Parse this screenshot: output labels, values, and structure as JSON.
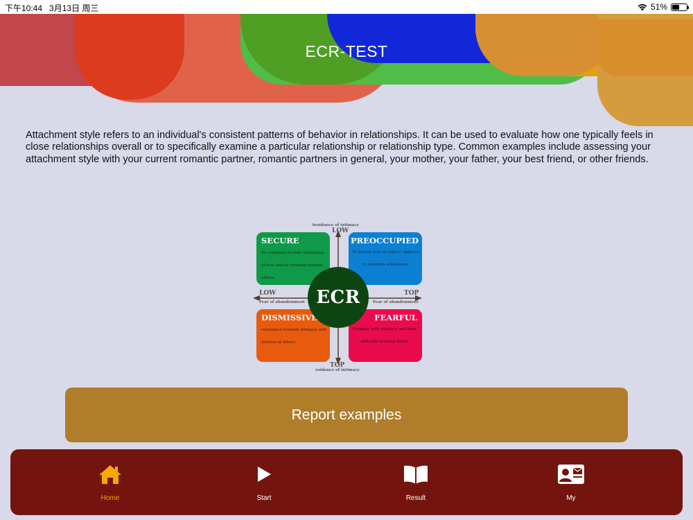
{
  "status_bar": {
    "time": "下午10:44",
    "date": "3月13日 周三",
    "battery": "51%",
    "battery_level": 0.51
  },
  "header": {
    "title": "ECR-TEST"
  },
  "description": "Attachment style refers to an individual's consistent patterns of behavior in relationships. It can be used to evaluate how one typically feels in close relationships overall or to specifically examine a particular relationship or relationship type. Common examples include assessing your attachment style with your current romantic partner, romantic partners in general, your mother, your father, your best friend, or other friends.",
  "diagram": {
    "center": "ECR",
    "axes": {
      "vertical_caption_top": "Avoidance of intimacy",
      "vertical_low": "LOW",
      "vertical_top": "TOP",
      "vertical_caption_bottom": "voidance of intimacy",
      "horizontal_low": "LOW",
      "horizontal_caption_left": "Fear of abandonment",
      "horizontal_top": "TOP",
      "horizontal_caption_right": "Fear of abandonment"
    },
    "quadrants": {
      "secure": {
        "title": "SECURE",
        "desc": "Be confident in their worthiness of love and be trusting towards others.",
        "color": "#0e9a48"
      },
      "preoccupied": {
        "title": "PREOCCUPIED",
        "desc": "To heavily rely on others' approval to maintain self-esteem.",
        "color": "#0b80d3"
      },
      "dismissive": {
        "title": "DISMISSIVE",
        "desc": "reluctance towards intimacy and distrust of others",
        "color": "#e85b0e"
      },
      "fearful": {
        "title": "FEARFUL",
        "desc": "Struggle with intimacy and have difficulty trusting others",
        "color": "#e90b4d"
      }
    }
  },
  "report_button": {
    "label": "Report examples",
    "color": "#b07d2a"
  },
  "tab_bar": {
    "color": "#73150e",
    "active_color": "#f6a700",
    "tabs": [
      {
        "label": "Home",
        "icon": "home-icon",
        "active": true
      },
      {
        "label": "Start",
        "icon": "play-icon",
        "active": false
      },
      {
        "label": "Result",
        "icon": "book-icon",
        "active": false
      },
      {
        "label": "My",
        "icon": "contact-card-icon",
        "active": false
      }
    ]
  }
}
